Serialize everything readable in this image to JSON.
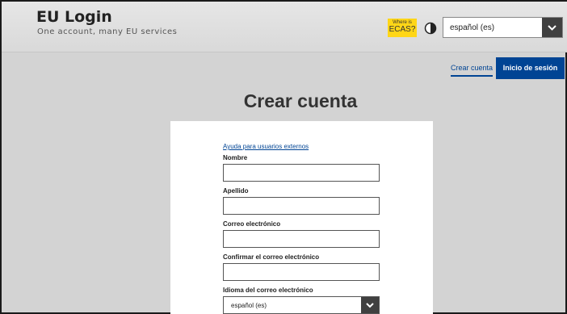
{
  "header": {
    "title": "EU Login",
    "subtitle": "One account, many EU services",
    "ecas_small": "Where is",
    "ecas_big": "ECAS?",
    "language_value": "español (es)"
  },
  "nav": {
    "create_account": "Crear cuenta",
    "login": "Inicio de sesión"
  },
  "page": {
    "title": "Crear cuenta"
  },
  "form": {
    "help_link": "Ayuda para usuarios externos",
    "first_name_label": "Nombre",
    "first_name_value": "",
    "last_name_label": "Apellido",
    "last_name_value": "",
    "email_label": "Correo electrónico",
    "email_value": "",
    "confirm_email_label": "Confirmar el correo electrónico",
    "confirm_email_value": "",
    "email_language_label": "Idioma del correo electrónico",
    "email_language_value": "español (es)"
  },
  "colors": {
    "accent": "#004494",
    "ecas_badge": "#ffd617",
    "select_arrow_bg": "#404040"
  },
  "icons": {
    "contrast": "contrast-icon",
    "dropdown": "chevron-down-icon"
  }
}
